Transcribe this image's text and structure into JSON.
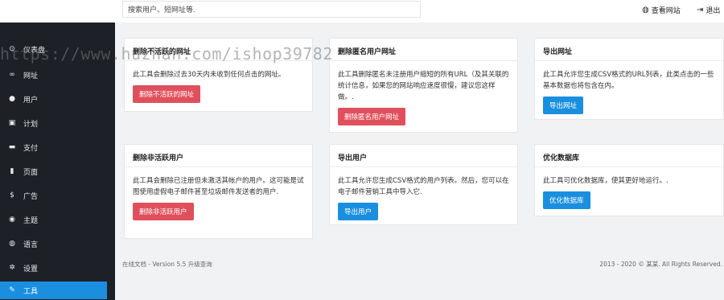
{
  "topbar": {
    "search_value": "搜索用户、短网址等.",
    "view_site": "查看网站",
    "logout": "退出"
  },
  "sidebar": {
    "items": [
      {
        "icon": "dashboard-icon",
        "glyph": "⊙",
        "label": "仪表盘"
      },
      {
        "icon": "link-icon",
        "glyph": "🔗",
        "label": "网址"
      },
      {
        "icon": "user-icon",
        "glyph": "●",
        "label": "用户"
      },
      {
        "icon": "briefcase-icon",
        "glyph": "▣",
        "label": "计划"
      },
      {
        "icon": "card-icon",
        "glyph": "▬",
        "label": "支付"
      },
      {
        "icon": "page-icon",
        "glyph": "▮",
        "label": "页面"
      },
      {
        "icon": "dollar-icon",
        "glyph": "$",
        "label": "广告"
      },
      {
        "icon": "eye-icon",
        "glyph": "◉",
        "label": "主题"
      },
      {
        "icon": "globe-icon",
        "glyph": "◍",
        "label": "语言"
      },
      {
        "icon": "gear-icon",
        "glyph": "✲",
        "label": "设置"
      },
      {
        "icon": "wrench-icon",
        "glyph": "✎",
        "label": "工具"
      }
    ],
    "active": "工具"
  },
  "cards": [
    {
      "title": "删除不活跃的网址",
      "text": "此工具会删除过去30天内未收到任何点击的网址。",
      "button": "删除不活跃的网址",
      "button_color": "#e0505c"
    },
    {
      "title": "删除匿名用户网址",
      "text": "此工具删除匿名未注册用户缩短的所有URL（及其关联的统计信息，如果您的网站响应速度很慢，建议您这样做。.",
      "button": "删除匿名用户网址",
      "button_color": "#e0505c"
    },
    {
      "title": "导出网址",
      "text": "此工具允许您生成CSV格式的URL列表，此类点击的一些基本数据也将包含在内。",
      "button": "导出网址",
      "button_color": "#1a8fe0"
    },
    {
      "title": "删除非活跃用户",
      "text": "此工具会删除已注册但未激活其帐户的用户。这可能是试图使用虚假电子邮件甚至垃圾邮件发送者的用户.",
      "button": "删除非活跃用户",
      "button_color": "#e0505c"
    },
    {
      "title": "导出用户",
      "text": "此工具允许您生成CSV格式的用户列表。然后，您可以在电子邮件营销工具中导入它.",
      "button": "导出用户",
      "button_color": "#1a8fe0"
    },
    {
      "title": "优化数据库",
      "text": "此工具可优化数据库，使其更好地运行。.",
      "button": "优化数据库",
      "button_color": "#1a8fe0"
    }
  ],
  "footer": {
    "left": "在线文档 - Version 5.5 升级查询",
    "right": "2013 - 2020 © 某某. All Rights Reserved."
  },
  "watermark": "https://www.huzhan.com/ishop39782"
}
